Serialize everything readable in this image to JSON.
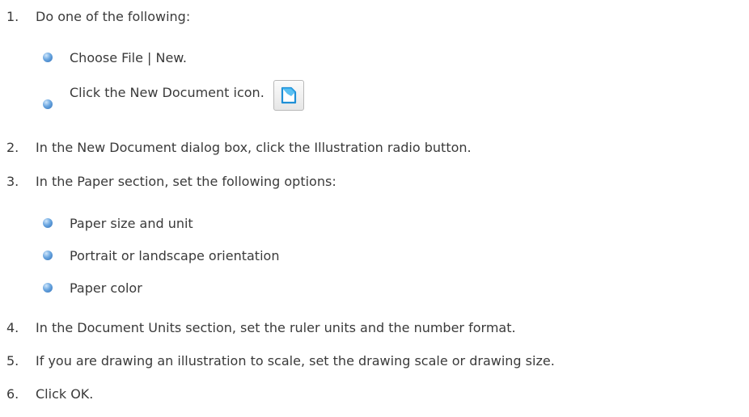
{
  "steps": [
    {
      "num": "1.",
      "text": "Do one of the following:"
    },
    {
      "num": "2.",
      "text": "In the New Document dialog box, click the Illustration radio button."
    },
    {
      "num": "3.",
      "text": "In the Paper section, set the following options:"
    },
    {
      "num": "4.",
      "text": "In the Document Units section, set the ruler units and the number format."
    },
    {
      "num": "5.",
      "text": "If you are drawing an illustration to scale, set the drawing scale or drawing size."
    },
    {
      "num": "6.",
      "text": "Click OK."
    }
  ],
  "step1_bullets": [
    "Choose File | New.",
    "Click the New Document icon."
  ],
  "step3_bullets": [
    "Paper size and unit",
    "Portrait or landscape orientation",
    "Paper color"
  ],
  "icons": {
    "new_document": "new-document-icon",
    "bullet": "bullet-dot"
  },
  "colors": {
    "text": "#3a3a3a",
    "bullet": "#4a8ad0",
    "icon_blue": "#2aa3e6"
  }
}
